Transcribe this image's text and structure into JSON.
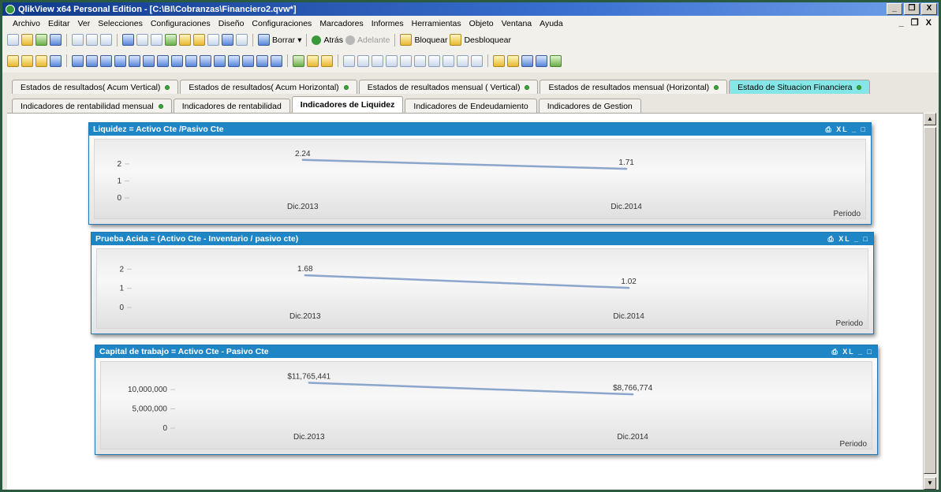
{
  "window": {
    "title": "QlikView x64 Personal Edition - [C:\\BI\\Cobranzas\\Financiero2.qvw*]",
    "controls": [
      "_",
      "❐",
      "X"
    ],
    "mdi_controls": "_ ❐ X"
  },
  "menu": [
    "Archivo",
    "Editar",
    "Ver",
    "Selecciones",
    "Configuraciones",
    "Diseño",
    "Configuraciones",
    "Marcadores",
    "Informes",
    "Herramientas",
    "Objeto",
    "Ventana",
    "Ayuda"
  ],
  "toolbar": {
    "borrar": "Borrar",
    "atras": "Atrás",
    "adelante": "Adelante",
    "bloquear": "Bloquear",
    "desbloquear": "Desbloquear"
  },
  "tabs_row1": [
    {
      "label": "Estados de resultados( Acum Vertical)",
      "dot": true
    },
    {
      "label": "Estados de resultados( Acum Horizontal)",
      "dot": true
    },
    {
      "label": "Estados de resultados mensual ( Vertical)",
      "dot": true
    },
    {
      "label": "Estados de resultados mensual (Horizontal)",
      "dot": true
    },
    {
      "label": "Estado de Situacion Financiera",
      "dot": true
    }
  ],
  "tabs_row2": [
    {
      "label": "Indicadores de rentabilidad mensual",
      "dot": true
    },
    {
      "label": "Indicadores de rentabilidad",
      "dot": false
    },
    {
      "label": "Indicadores de Liquidez",
      "dot": false,
      "active": true
    },
    {
      "label": "Indicadores de Endeudamiento",
      "dot": false
    },
    {
      "label": "Indicadores de Gestion",
      "dot": false
    }
  ],
  "chart_controls": "⎙ XL _ □",
  "chart_data": [
    {
      "type": "line",
      "title": "Liquidez = Activo Cte /Pasivo Cte",
      "xlabel": "Periodo",
      "categories": [
        "Dic.2013",
        "Dic.2014"
      ],
      "values": [
        2.24,
        1.71
      ],
      "value_labels": [
        "2.24",
        "1.71"
      ],
      "yticks": [
        "0",
        "1",
        "2"
      ],
      "ylim": [
        0,
        2.6
      ],
      "line_color": "#8aa6cc"
    },
    {
      "type": "line",
      "title": "Prueba Acida = (Activo Cte - Inventario / pasivo cte)",
      "xlabel": "Periodo",
      "categories": [
        "Dic.2013",
        "Dic.2014"
      ],
      "values": [
        1.68,
        1.02
      ],
      "value_labels": [
        "1.68",
        "1.02"
      ],
      "yticks": [
        "0",
        "1",
        "2"
      ],
      "ylim": [
        0,
        2.3
      ],
      "line_color": "#8aa6cc"
    },
    {
      "type": "line",
      "title": "Capital de trabajo = Activo Cte - Pasivo Cte",
      "xlabel": "Periodo",
      "categories": [
        "Dic.2013",
        "Dic.2014"
      ],
      "values": [
        11765441,
        8766774
      ],
      "value_labels": [
        "$11,765,441",
        "$8,766,774"
      ],
      "yticks": [
        "0",
        "5,000,000",
        "10,000,000"
      ],
      "ylim": [
        0,
        13500000
      ],
      "line_color": "#8aa6cc"
    }
  ]
}
